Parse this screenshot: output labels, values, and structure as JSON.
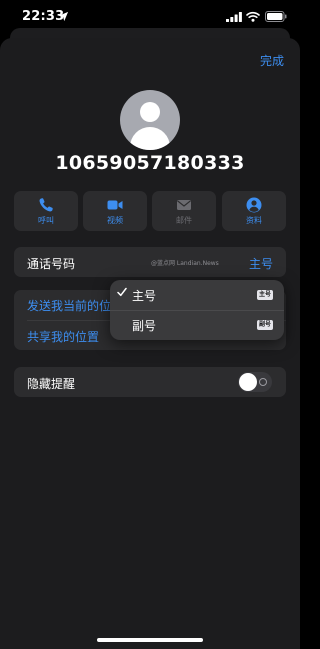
{
  "status_bar": {
    "time": "22:33"
  },
  "header": {
    "done_label": "完成"
  },
  "contact": {
    "number": "10659057180333"
  },
  "actions": [
    {
      "label": "呼叫",
      "icon": "phone-icon",
      "enabled": true
    },
    {
      "label": "视频",
      "icon": "video-icon",
      "enabled": true
    },
    {
      "label": "邮件",
      "icon": "mail-icon",
      "enabled": false
    },
    {
      "label": "资料",
      "icon": "person-circle-icon",
      "enabled": true
    }
  ],
  "phone_row": {
    "label": "通话号码",
    "value": "主号",
    "watermark": "@蓝点网 Landian.News"
  },
  "location": {
    "send_current": "发送我当前的位置",
    "share": "共享我的位置"
  },
  "hide_alerts": {
    "label": "隐藏提醒",
    "enabled": false
  },
  "line_menu": {
    "options": [
      {
        "label": "主号",
        "badge": "主号",
        "selected": true
      },
      {
        "label": "副号",
        "badge": "副号",
        "selected": false
      }
    ]
  },
  "colors": {
    "accent": "#3d8ef0",
    "sheet": "#1c1c1e",
    "card": "#2c2c2e"
  }
}
